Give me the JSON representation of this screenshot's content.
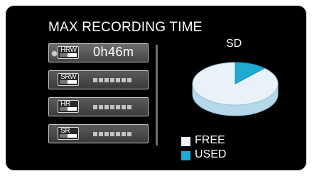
{
  "title": "MAX RECORDING TIME",
  "modes": [
    {
      "label": "HRW",
      "time": "0h46m",
      "selected": true
    },
    {
      "label": "SRW",
      "time": "",
      "selected": false
    },
    {
      "label": "HR",
      "time": "",
      "selected": false
    },
    {
      "label": "SR",
      "time": "",
      "selected": false
    }
  ],
  "media": {
    "label": "SD"
  },
  "usage": {
    "used_fraction": 0.12
  },
  "legend": {
    "free": "FREE",
    "used": "USED"
  },
  "colors": {
    "free": "#e8f2f8",
    "used": "#1eaad2",
    "pie_side": "#b6d8e8"
  }
}
